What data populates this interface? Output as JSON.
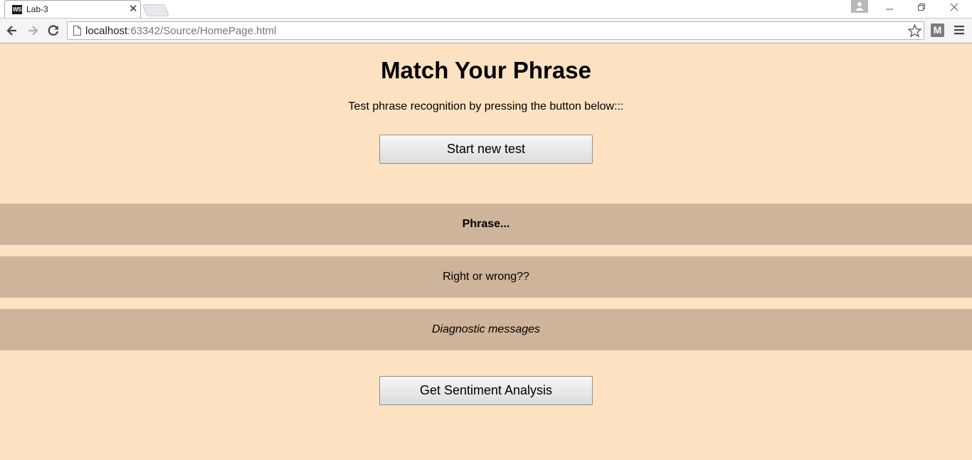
{
  "browser": {
    "tab_title": "Lab-3",
    "favicon_text": "WS",
    "url_host": "localhost",
    "url_rest": ":63342/Source/HomePage.html",
    "extension_label": "M",
    "icons": [
      "back-arrow-icon",
      "forward-arrow-icon",
      "reload-icon",
      "page-icon",
      "star-icon",
      "menu-icon",
      "profile-icon",
      "minimize-icon",
      "restore-icon",
      "close-icon"
    ]
  },
  "page": {
    "background": "#fde2c1",
    "band_color": "#cdb49a",
    "title": "Match Your Phrase",
    "subtitle": "Test phrase recognition by pressing the button below:::",
    "start_button": "Start new test",
    "phrase_text": "Phrase...",
    "result_text": "Right or wrong??",
    "diagnostic_text": "Diagnostic messages",
    "sentiment_button": "Get Sentiment Analysis"
  }
}
